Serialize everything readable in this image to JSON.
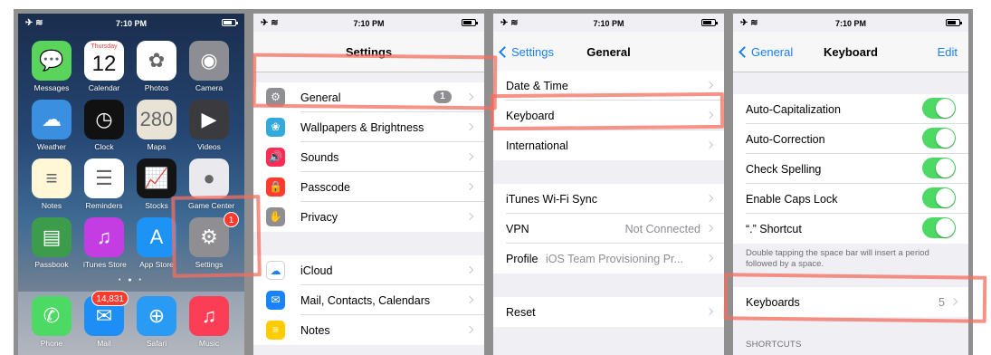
{
  "status_bar": {
    "time": "7:10 PM"
  },
  "home": {
    "apps": [
      {
        "name": "Messages",
        "glyph": "💬",
        "bg": "#5ad45a"
      },
      {
        "name": "Calendar",
        "glyph": "12",
        "bg": "#ffffff"
      },
      {
        "name": "Photos",
        "glyph": "✿",
        "bg": "#ffffff"
      },
      {
        "name": "Camera",
        "glyph": "◉",
        "bg": "#8c8e93"
      },
      {
        "name": "Weather",
        "glyph": "☁",
        "bg": "#3a8fe0"
      },
      {
        "name": "Clock",
        "glyph": "◷",
        "bg": "#111111"
      },
      {
        "name": "Maps",
        "glyph": "280",
        "bg": "#e9e3d5"
      },
      {
        "name": "Videos",
        "glyph": "▶",
        "bg": "#3b3b3f"
      },
      {
        "name": "Notes",
        "glyph": "≡",
        "bg": "#fff7d6"
      },
      {
        "name": "Reminders",
        "glyph": "☰",
        "bg": "#ffffff"
      },
      {
        "name": "Stocks",
        "glyph": "📈",
        "bg": "#141414"
      },
      {
        "name": "Game Center",
        "glyph": "●",
        "bg": "#e9e9ee"
      },
      {
        "name": "Passbook",
        "glyph": "▤",
        "bg": "#3d9b4c"
      },
      {
        "name": "iTunes Store",
        "glyph": "♫",
        "bg": "#c33de2"
      },
      {
        "name": "App Store",
        "glyph": "A",
        "bg": "#1c93f5"
      },
      {
        "name": "Settings",
        "glyph": "⚙",
        "bg": "#8e8e93"
      }
    ],
    "calendar_day": "Thursday",
    "settings_badge": "1",
    "dock": [
      {
        "name": "Phone",
        "glyph": "✆",
        "bg": "#4cd964"
      },
      {
        "name": "Mail",
        "glyph": "✉",
        "bg": "#1c8ef5"
      },
      {
        "name": "Safari",
        "glyph": "⊕",
        "bg": "#2a9bf5"
      },
      {
        "name": "Music",
        "glyph": "♫",
        "bg": "#fc3d56"
      }
    ],
    "mail_badge": "14,831",
    "page_dots": "• ● •"
  },
  "settings": {
    "title": "Settings",
    "rows": [
      {
        "label": "General",
        "badge": "1",
        "icon": "gear-icon",
        "glyph": "⚙",
        "color": "#8e8e93"
      },
      {
        "label": "Wallpapers & Brightness",
        "icon": "flower-icon",
        "glyph": "❀",
        "color": "#34aadc"
      },
      {
        "label": "Sounds",
        "icon": "speaker-icon",
        "glyph": "🔊",
        "color": "#ff2d55"
      },
      {
        "label": "Passcode",
        "icon": "lock-icon",
        "glyph": "🔒",
        "color": "#ff3b30"
      },
      {
        "label": "Privacy",
        "icon": "hand-icon",
        "glyph": "✋",
        "color": "#8e8e93"
      },
      {
        "label": "iCloud",
        "icon": "cloud-icon",
        "glyph": "☁",
        "color": "#ffffff"
      },
      {
        "label": "Mail, Contacts, Calendars",
        "icon": "mail-icon",
        "glyph": "✉",
        "color": "#1a82fb"
      },
      {
        "label": "Notes",
        "icon": "notes-icon",
        "glyph": "≡",
        "color": "#ffcc00"
      }
    ]
  },
  "general": {
    "back": "Settings",
    "title": "General",
    "rows": [
      {
        "label": "Date & Time"
      },
      {
        "label": "Keyboard"
      },
      {
        "label": "International"
      },
      {
        "label": "iTunes Wi-Fi Sync"
      },
      {
        "label": "VPN",
        "detail": "Not Connected"
      },
      {
        "label": "Profile",
        "detail": "iOS Team Provisioning Pr..."
      },
      {
        "label": "Reset"
      }
    ]
  },
  "keyboard": {
    "back": "General",
    "title": "Keyboard",
    "edit": "Edit",
    "toggles": [
      {
        "label": "Auto-Capitalization",
        "on": true
      },
      {
        "label": "Auto-Correction",
        "on": true
      },
      {
        "label": "Check Spelling",
        "on": true
      },
      {
        "label": "Enable Caps Lock",
        "on": true
      },
      {
        "label": "“.” Shortcut",
        "on": true
      }
    ],
    "footnote": "Double tapping the space bar will insert a period followed by a space.",
    "keyboards_label": "Keyboards",
    "keyboards_count": "5",
    "shortcuts_header": "SHORTCUTS"
  },
  "colors": {
    "accent": "#1a7efb",
    "toggle_on": "#4cd964",
    "highlight": "#f46e5f"
  }
}
